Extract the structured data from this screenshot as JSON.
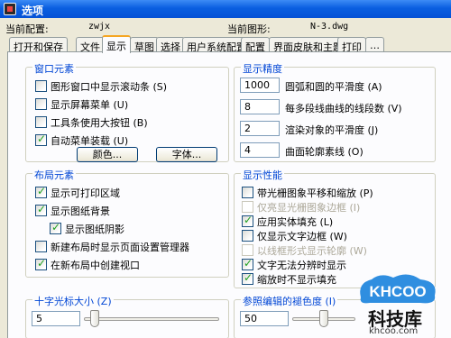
{
  "window": {
    "title": "选项"
  },
  "info": {
    "current_profile_label": "当前配置:",
    "current_profile_value": "zwjx",
    "current_drawing_label": "当前图形:",
    "current_drawing_value": "N-3.dwg"
  },
  "tabs": [
    {
      "label": "打开和保存"
    },
    {
      "label": "文件"
    },
    {
      "label": "显示"
    },
    {
      "label": "草图"
    },
    {
      "label": "选择"
    },
    {
      "label": "用户系统配置"
    },
    {
      "label": "配置"
    },
    {
      "label": "界面皮肤和主题"
    },
    {
      "label": "打印"
    },
    {
      "label": "…"
    }
  ],
  "window_elements": {
    "title": "窗口元素",
    "items": [
      {
        "label": "图形窗口中显示滚动条 (S)",
        "checked": false
      },
      {
        "label": "显示屏幕菜单 (U)",
        "checked": false
      },
      {
        "label": "工具条使用大按钮 (B)",
        "checked": false
      },
      {
        "label": "自动菜单装载 (U)",
        "checked": true
      }
    ],
    "color_button": "颜色...",
    "font_button": "字体..."
  },
  "display_resolution": {
    "title": "显示精度",
    "items": [
      {
        "value": "1000",
        "label": "圆弧和圆的平滑度 (A)"
      },
      {
        "value": "8",
        "label": "每多段线曲线的线段数 (V)"
      },
      {
        "value": "2",
        "label": "渲染对象的平滑度 (J)"
      },
      {
        "value": "4",
        "label": "曲面轮廓素线 (O)"
      }
    ]
  },
  "layout_elements": {
    "title": "布局元素",
    "items": [
      {
        "label": "显示可打印区域",
        "checked": true
      },
      {
        "label": "显示图纸背景",
        "checked": true
      },
      {
        "label": "显示图纸阴影",
        "checked": true
      },
      {
        "label": "新建布局时显示页面设置管理器",
        "checked": false
      },
      {
        "label": "在新布局中创建视口",
        "checked": true
      }
    ]
  },
  "display_performance": {
    "title": "显示性能",
    "items": [
      {
        "label": "带光栅图象平移和缩放 (P)",
        "checked": false,
        "disabled": false
      },
      {
        "label": "仅亮显光栅图象边框 (I)",
        "checked": false,
        "disabled": true
      },
      {
        "label": "应用实体填充 (L)",
        "checked": true,
        "disabled": false
      },
      {
        "label": "仅显示文字边框 (W)",
        "checked": false,
        "disabled": false
      },
      {
        "label": "以线框形式显示轮廓 (W)",
        "checked": false,
        "disabled": true
      },
      {
        "label": "文字无法分辨时显示",
        "checked": true,
        "disabled": false
      },
      {
        "label": "缩放时不显示填充",
        "checked": true,
        "disabled": false
      }
    ]
  },
  "crosshair": {
    "title": "十字光标大小 (Z)",
    "value": "5",
    "slider_fraction": 0.05
  },
  "xref_fade": {
    "title": "参照编辑的褪色度 (I)",
    "value": "50",
    "slider_fraction": 0.5
  },
  "watermark": {
    "brand": "KHCOO",
    "text": "科技库",
    "url": "khcoo.com"
  }
}
